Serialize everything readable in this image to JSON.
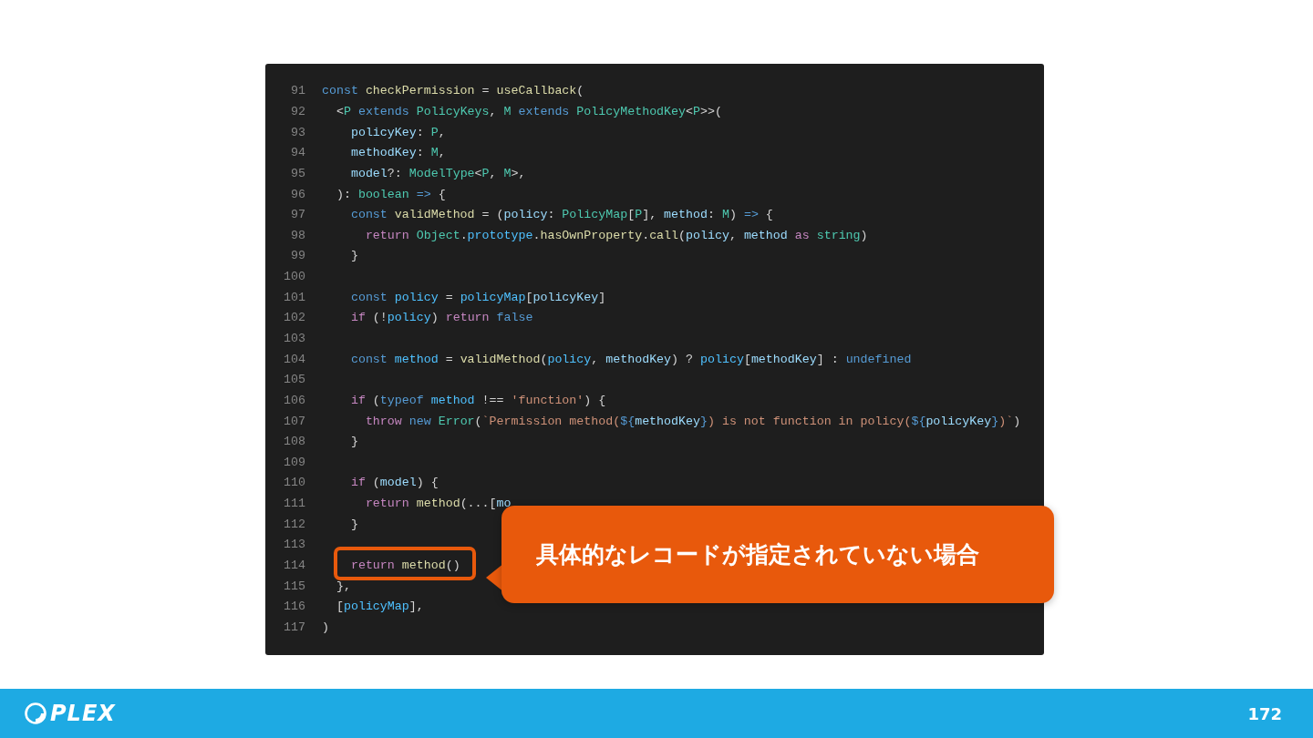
{
  "code": {
    "lines": [
      {
        "number": "91",
        "tokens": [
          {
            "text": "const ",
            "kind": "kw"
          },
          {
            "text": "checkPermission",
            "kind": "fn"
          },
          {
            "text": " = ",
            "kind": "op"
          },
          {
            "text": "useCallback",
            "kind": "fn"
          },
          {
            "text": "(",
            "kind": "op"
          }
        ]
      },
      {
        "number": "92",
        "tokens": [
          {
            "text": "  <",
            "kind": "op"
          },
          {
            "text": "P",
            "kind": "type"
          },
          {
            "text": " extends ",
            "kind": "kw"
          },
          {
            "text": "PolicyKeys",
            "kind": "type"
          },
          {
            "text": ", ",
            "kind": "op"
          },
          {
            "text": "M",
            "kind": "type"
          },
          {
            "text": " extends ",
            "kind": "kw"
          },
          {
            "text": "PolicyMethodKey",
            "kind": "type"
          },
          {
            "text": "<",
            "kind": "op"
          },
          {
            "text": "P",
            "kind": "type"
          },
          {
            "text": ">>(",
            "kind": "op"
          }
        ]
      },
      {
        "number": "93",
        "tokens": [
          {
            "text": "    policyKey",
            "kind": "var"
          },
          {
            "text": ": ",
            "kind": "op"
          },
          {
            "text": "P",
            "kind": "type"
          },
          {
            "text": ",",
            "kind": "op"
          }
        ]
      },
      {
        "number": "94",
        "tokens": [
          {
            "text": "    methodKey",
            "kind": "var"
          },
          {
            "text": ": ",
            "kind": "op"
          },
          {
            "text": "M",
            "kind": "type"
          },
          {
            "text": ",",
            "kind": "op"
          }
        ]
      },
      {
        "number": "95",
        "tokens": [
          {
            "text": "    model",
            "kind": "var"
          },
          {
            "text": "?: ",
            "kind": "op"
          },
          {
            "text": "ModelType",
            "kind": "type"
          },
          {
            "text": "<",
            "kind": "op"
          },
          {
            "text": "P",
            "kind": "type"
          },
          {
            "text": ", ",
            "kind": "op"
          },
          {
            "text": "M",
            "kind": "type"
          },
          {
            "text": ">,",
            "kind": "op"
          }
        ]
      },
      {
        "number": "96",
        "tokens": [
          {
            "text": "  ): ",
            "kind": "op"
          },
          {
            "text": "boolean",
            "kind": "type"
          },
          {
            "text": " => ",
            "kind": "kw"
          },
          {
            "text": "{",
            "kind": "op"
          }
        ]
      },
      {
        "number": "97",
        "tokens": [
          {
            "text": "    const ",
            "kind": "kw"
          },
          {
            "text": "validMethod",
            "kind": "fn"
          },
          {
            "text": " = (",
            "kind": "op"
          },
          {
            "text": "policy",
            "kind": "var"
          },
          {
            "text": ": ",
            "kind": "op"
          },
          {
            "text": "PolicyMap",
            "kind": "type"
          },
          {
            "text": "[",
            "kind": "op"
          },
          {
            "text": "P",
            "kind": "type"
          },
          {
            "text": "], ",
            "kind": "op"
          },
          {
            "text": "method",
            "kind": "var"
          },
          {
            "text": ": ",
            "kind": "op"
          },
          {
            "text": "M",
            "kind": "type"
          },
          {
            "text": ") ",
            "kind": "op"
          },
          {
            "text": "=>",
            "kind": "kw"
          },
          {
            "text": " {",
            "kind": "op"
          }
        ]
      },
      {
        "number": "98",
        "tokens": [
          {
            "text": "      return ",
            "kind": "ctrl"
          },
          {
            "text": "Object",
            "kind": "type"
          },
          {
            "text": ".",
            "kind": "op"
          },
          {
            "text": "prototype",
            "kind": "const"
          },
          {
            "text": ".",
            "kind": "op"
          },
          {
            "text": "hasOwnProperty",
            "kind": "fn"
          },
          {
            "text": ".",
            "kind": "op"
          },
          {
            "text": "call",
            "kind": "fn"
          },
          {
            "text": "(",
            "kind": "op"
          },
          {
            "text": "policy",
            "kind": "var"
          },
          {
            "text": ", ",
            "kind": "op"
          },
          {
            "text": "method",
            "kind": "var"
          },
          {
            "text": " as ",
            "kind": "ctrl"
          },
          {
            "text": "string",
            "kind": "type"
          },
          {
            "text": ")",
            "kind": "op"
          }
        ]
      },
      {
        "number": "99",
        "tokens": [
          {
            "text": "    }",
            "kind": "op"
          }
        ]
      },
      {
        "number": "100"
      },
      {
        "number": "101",
        "tokens": [
          {
            "text": "    const ",
            "kind": "kw"
          },
          {
            "text": "policy",
            "kind": "const"
          },
          {
            "text": " = ",
            "kind": "op"
          },
          {
            "text": "policyMap",
            "kind": "const"
          },
          {
            "text": "[",
            "kind": "op"
          },
          {
            "text": "policyKey",
            "kind": "var"
          },
          {
            "text": "]",
            "kind": "op"
          }
        ]
      },
      {
        "number": "102",
        "tokens": [
          {
            "text": "    if ",
            "kind": "ctrl"
          },
          {
            "text": "(!",
            "kind": "op"
          },
          {
            "text": "policy",
            "kind": "const"
          },
          {
            "text": ") ",
            "kind": "op"
          },
          {
            "text": "return ",
            "kind": "ctrl"
          },
          {
            "text": "false",
            "kind": "kw"
          }
        ]
      },
      {
        "number": "103"
      },
      {
        "number": "104",
        "tokens": [
          {
            "text": "    const ",
            "kind": "kw"
          },
          {
            "text": "method",
            "kind": "const"
          },
          {
            "text": " = ",
            "kind": "op"
          },
          {
            "text": "validMethod",
            "kind": "fn"
          },
          {
            "text": "(",
            "kind": "op"
          },
          {
            "text": "policy",
            "kind": "const"
          },
          {
            "text": ", ",
            "kind": "op"
          },
          {
            "text": "methodKey",
            "kind": "var"
          },
          {
            "text": ") ? ",
            "kind": "op"
          },
          {
            "text": "policy",
            "kind": "const"
          },
          {
            "text": "[",
            "kind": "op"
          },
          {
            "text": "methodKey",
            "kind": "var"
          },
          {
            "text": "] : ",
            "kind": "op"
          },
          {
            "text": "undefined",
            "kind": "kw"
          }
        ]
      },
      {
        "number": "105"
      },
      {
        "number": "106",
        "tokens": [
          {
            "text": "    if ",
            "kind": "ctrl"
          },
          {
            "text": "(",
            "kind": "op"
          },
          {
            "text": "typeof ",
            "kind": "kw"
          },
          {
            "text": "method",
            "kind": "const"
          },
          {
            "text": " !== ",
            "kind": "op"
          },
          {
            "text": "'function'",
            "kind": "str"
          },
          {
            "text": ") {",
            "kind": "op"
          }
        ]
      },
      {
        "number": "107",
        "tokens": [
          {
            "text": "      throw ",
            "kind": "ctrl"
          },
          {
            "text": "new ",
            "kind": "kw"
          },
          {
            "text": "Error",
            "kind": "type"
          },
          {
            "text": "(",
            "kind": "op"
          },
          {
            "text": "`Permission method(",
            "kind": "str"
          },
          {
            "text": "${",
            "kind": "kw"
          },
          {
            "text": "methodKey",
            "kind": "var"
          },
          {
            "text": "}",
            "kind": "kw"
          },
          {
            "text": ") is not function in policy(",
            "kind": "str"
          },
          {
            "text": "${",
            "kind": "kw"
          },
          {
            "text": "policyKey",
            "kind": "var"
          },
          {
            "text": "}",
            "kind": "kw"
          },
          {
            "text": ")`",
            "kind": "str"
          },
          {
            "text": ")",
            "kind": "op"
          }
        ]
      },
      {
        "number": "108",
        "tokens": [
          {
            "text": "    }",
            "kind": "op"
          }
        ]
      },
      {
        "number": "109"
      },
      {
        "number": "110",
        "tokens": [
          {
            "text": "    if ",
            "kind": "ctrl"
          },
          {
            "text": "(",
            "kind": "op"
          },
          {
            "text": "model",
            "kind": "var"
          },
          {
            "text": ") {",
            "kind": "op"
          }
        ]
      },
      {
        "number": "111",
        "tokens": [
          {
            "text": "      return ",
            "kind": "ctrl"
          },
          {
            "text": "method",
            "kind": "fn"
          },
          {
            "text": "(...[",
            "kind": "op"
          },
          {
            "text": "mo",
            "kind": "var"
          }
        ]
      },
      {
        "number": "112",
        "tokens": [
          {
            "text": "    }",
            "kind": "op"
          }
        ]
      },
      {
        "number": "113"
      },
      {
        "number": "114",
        "tokens": [
          {
            "text": "    return ",
            "kind": "ctrl"
          },
          {
            "text": "method",
            "kind": "fn"
          },
          {
            "text": "()",
            "kind": "op"
          }
        ]
      },
      {
        "number": "115",
        "tokens": [
          {
            "text": "  },",
            "kind": "op"
          }
        ]
      },
      {
        "number": "116",
        "tokens": [
          {
            "text": "  [",
            "kind": "op"
          },
          {
            "text": "policyMap",
            "kind": "const"
          },
          {
            "text": "],",
            "kind": "op"
          }
        ]
      },
      {
        "number": "117",
        "tokens": [
          {
            "text": ")",
            "kind": "op"
          }
        ]
      }
    ]
  },
  "callout": {
    "text": "具体的なレコードが指定されていない場合"
  },
  "footer": {
    "brand": "PLEX",
    "page_number": "172"
  }
}
